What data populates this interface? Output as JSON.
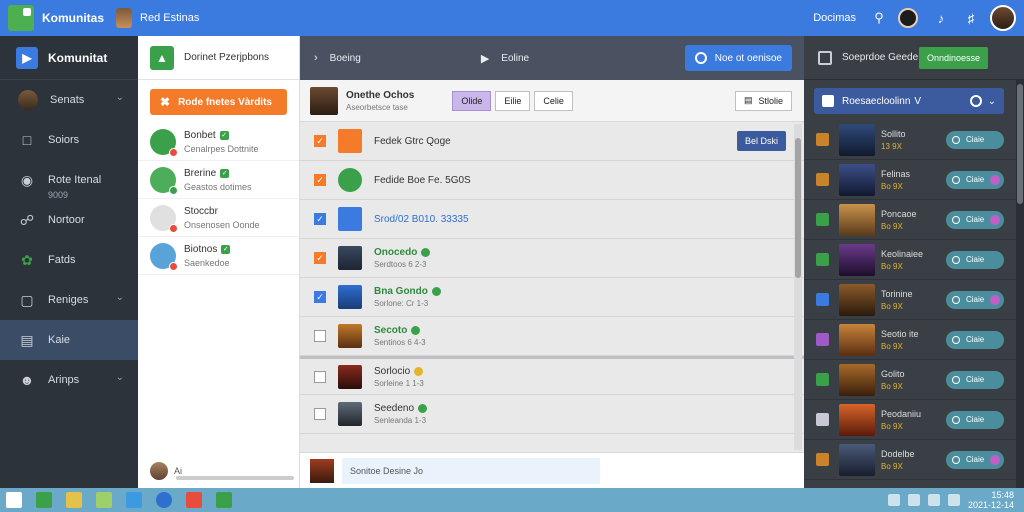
{
  "topbar": {
    "app_title": "Komunitas",
    "sub_title": "Red Estinas",
    "user_name": "Docimas",
    "icons": [
      "search-icon",
      "bell-icon",
      "music-icon"
    ]
  },
  "leftnav": {
    "brand_label": "Komunitat",
    "items": [
      {
        "label": "Senats",
        "sub": "",
        "icon": "avatar",
        "chevron": true
      },
      {
        "label": "Soiors",
        "sub": "",
        "icon": "message-icon",
        "chevron": false
      },
      {
        "label": "Rote Itenal",
        "sub": "9009",
        "icon": "circle-icon",
        "chevron": false
      },
      {
        "label": "Nortoor",
        "sub": "",
        "icon": "link-icon",
        "chevron": false
      },
      {
        "label": "Fatds",
        "sub": "",
        "icon": "leaf-icon",
        "chevron": false
      },
      {
        "label": "Reniges",
        "sub": "",
        "icon": "square-icon",
        "chevron": true
      },
      {
        "label": "Kaie",
        "sub": "",
        "icon": "doc-icon",
        "chevron": false
      },
      {
        "label": "Arinps",
        "sub": "",
        "icon": "people-icon",
        "chevron": true
      }
    ]
  },
  "contacts": {
    "header": "Dorinet Pzerjpbons",
    "action_label": "Rode fnetes Vàrdits",
    "list": [
      {
        "name": "Bonbet",
        "status": "Cenalrpes Dottnite"
      },
      {
        "name": "Brerine",
        "status": "Geastos dotimes"
      },
      {
        "name": "Stoccbr",
        "status": "Onsenosen Oonde"
      },
      {
        "name": "Biotnos",
        "status": "Saenkedoe"
      }
    ],
    "footer_text": "Ai"
  },
  "main": {
    "tab1": "Boeing",
    "tab2": "Eoline",
    "header_button": "Noe ot oenisoe",
    "toolbar": {
      "name": "Onethe Ochos",
      "sub": "Aseorbetsce tase",
      "buttons": [
        "Olide",
        "Eilie",
        "Celie"
      ],
      "right_button": "Stlolie"
    },
    "rows": [
      {
        "title": "Fedek Gtrc Qoge",
        "sub": "",
        "check": "orange",
        "style": "normal",
        "action": "Bel Dski"
      },
      {
        "title": "Fedide Boe Fe. 5G0S",
        "sub": "",
        "check": "orange",
        "style": "normal",
        "action": ""
      },
      {
        "title": "Srod/02 B010. 33335",
        "sub": "",
        "check": "blue",
        "style": "blue",
        "action": ""
      },
      {
        "title": "Onocedo",
        "sub": "Serdtoos 6 2-3",
        "check": "orange",
        "style": "green",
        "action": ""
      },
      {
        "title": "Bna Gondo",
        "sub": "Sorlone: Cr 1-3",
        "check": "blue",
        "style": "green",
        "action": ""
      },
      {
        "title": "Secoto",
        "sub": "Sentinos 6 4-3",
        "check": "none",
        "style": "green",
        "action": ""
      },
      {
        "title": "Sorlocio",
        "sub": "Sorleine 1 1-3",
        "check": "none",
        "style": "yellow",
        "action": ""
      },
      {
        "title": "Seedeno",
        "sub": "Senleanda 1-3",
        "check": "none",
        "style": "normal",
        "action": ""
      }
    ],
    "composer_text": "Sonitoe Desine Jo"
  },
  "right": {
    "header": "Soeprdoe Geede",
    "header_button": "Onndinoesse",
    "select_label": "Roesaecloolinn",
    "select_value": "V",
    "games": [
      {
        "title": "Sollito",
        "sub": "13 9X",
        "pill": "Ciaie"
      },
      {
        "title": "Felinas",
        "sub": "Bo 9X",
        "pill": "Ciaie"
      },
      {
        "title": "Poncaoe",
        "sub": "Bo 9X",
        "pill": "Ciaie"
      },
      {
        "title": "Keolinaiee",
        "sub": "Bo 9X",
        "pill": "Ciaie"
      },
      {
        "title": "Torinine",
        "sub": "Bo 9X",
        "pill": "Ciaie"
      },
      {
        "title": "Seotio ite",
        "sub": "Bo 9X",
        "pill": "Ciaie"
      },
      {
        "title": "Golito",
        "sub": "Bo 9X",
        "pill": "Ciaie"
      },
      {
        "title": "Peodaniiu",
        "sub": "Bo 9X",
        "pill": "Ciaie"
      },
      {
        "title": "Dodelbe",
        "sub": "Bo 9X",
        "pill": "Ciaie"
      }
    ]
  },
  "taskbar": {
    "clock_time": "15:48",
    "clock_date": "2021-12-14"
  },
  "colors": {
    "accent": "#3b7be0",
    "orange": "#f47b2a",
    "green": "#3aa14a",
    "nav_bg": "#2d333b"
  }
}
